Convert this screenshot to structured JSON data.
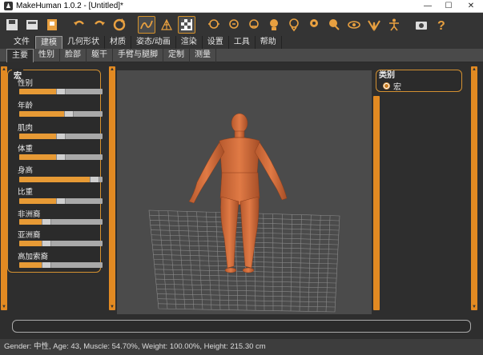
{
  "window": {
    "title": "MakeHuman 1.0.2 - [Untitled]*",
    "controls": [
      "—",
      "☐",
      "✕"
    ]
  },
  "toolbar": {
    "icons": [
      "save-icon",
      "load-icon",
      "export-icon",
      "undo-icon",
      "redo-icon",
      "reset-icon",
      "smooth-icon",
      "wireframe-icon",
      "background-icon",
      "front-view-icon",
      "back-view-icon",
      "left-view-icon",
      "right-view-icon",
      "top-view-icon",
      "bottom-view-icon",
      "reset-camera-icon",
      "skeleton-view-icon",
      "pose-icon",
      "symmetry-icon",
      "screenshot-icon",
      "help-icon"
    ]
  },
  "main_tabs": [
    "文件",
    "建模",
    "几何形状",
    "材质",
    "姿态/动画",
    "渲染",
    "设置",
    "工具",
    "帮助"
  ],
  "main_tab_selected": 1,
  "sub_tabs": [
    "主要",
    "性别",
    "脸部",
    "躯干",
    "手臂与腿脚",
    "定制",
    "测量"
  ],
  "sub_tab_selected": 0,
  "macro": {
    "title": "宏",
    "sliders": [
      {
        "label": "性别",
        "value": 0.5
      },
      {
        "label": "年龄",
        "value": 0.6
      },
      {
        "label": "肌肉",
        "value": 0.5
      },
      {
        "label": "体重",
        "value": 0.5
      },
      {
        "label": "身高",
        "value": 0.9
      },
      {
        "label": "比重",
        "value": 0.5
      },
      {
        "label": "非洲裔",
        "value": 0.33
      },
      {
        "label": "亚洲裔",
        "value": 0.33
      },
      {
        "label": "高加索裔",
        "value": 0.33
      }
    ]
  },
  "category": {
    "title": "类别",
    "option": "宏"
  },
  "status": "Gender: 中性, Age: 43, Muscle: 54.70%, Weight: 100.00%, Height: 215.30 cm"
}
